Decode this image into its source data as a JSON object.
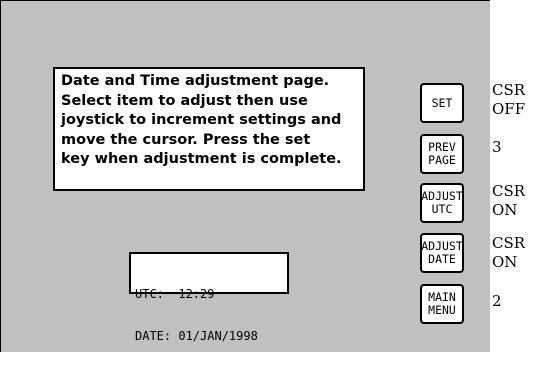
{
  "info": {
    "lines": [
      "Date and Time adjustment page.",
      "Select item to adjust then use",
      "joystick to increment settings and",
      "move the cursor. Press the set",
      "key when adjustment is complete."
    ]
  },
  "status": {
    "utc_line": "UTC:  12:29",
    "date_line": "DATE: 01/JAN/1998"
  },
  "keys": {
    "set": {
      "lines": [
        "SET"
      ]
    },
    "prev_page": {
      "lines": [
        "PREV",
        "PAGE"
      ]
    },
    "adjust_utc": {
      "lines": [
        "ADJUST",
        "UTC"
      ]
    },
    "adjust_date": {
      "lines": [
        "ADJUST",
        "DATE"
      ]
    },
    "main_menu": {
      "lines": [
        "MAIN",
        "MENU"
      ]
    }
  },
  "side_labels": {
    "set": [
      "CSR",
      "OFF"
    ],
    "prev_page": [
      "3"
    ],
    "adjust_utc": [
      "CSR",
      "ON"
    ],
    "adjust_date": [
      "CSR",
      "ON"
    ],
    "main_menu": [
      "2"
    ]
  },
  "colors": {
    "screen_background": "#c0c0c0",
    "box_background": "#ffffff",
    "text": "#000000"
  }
}
